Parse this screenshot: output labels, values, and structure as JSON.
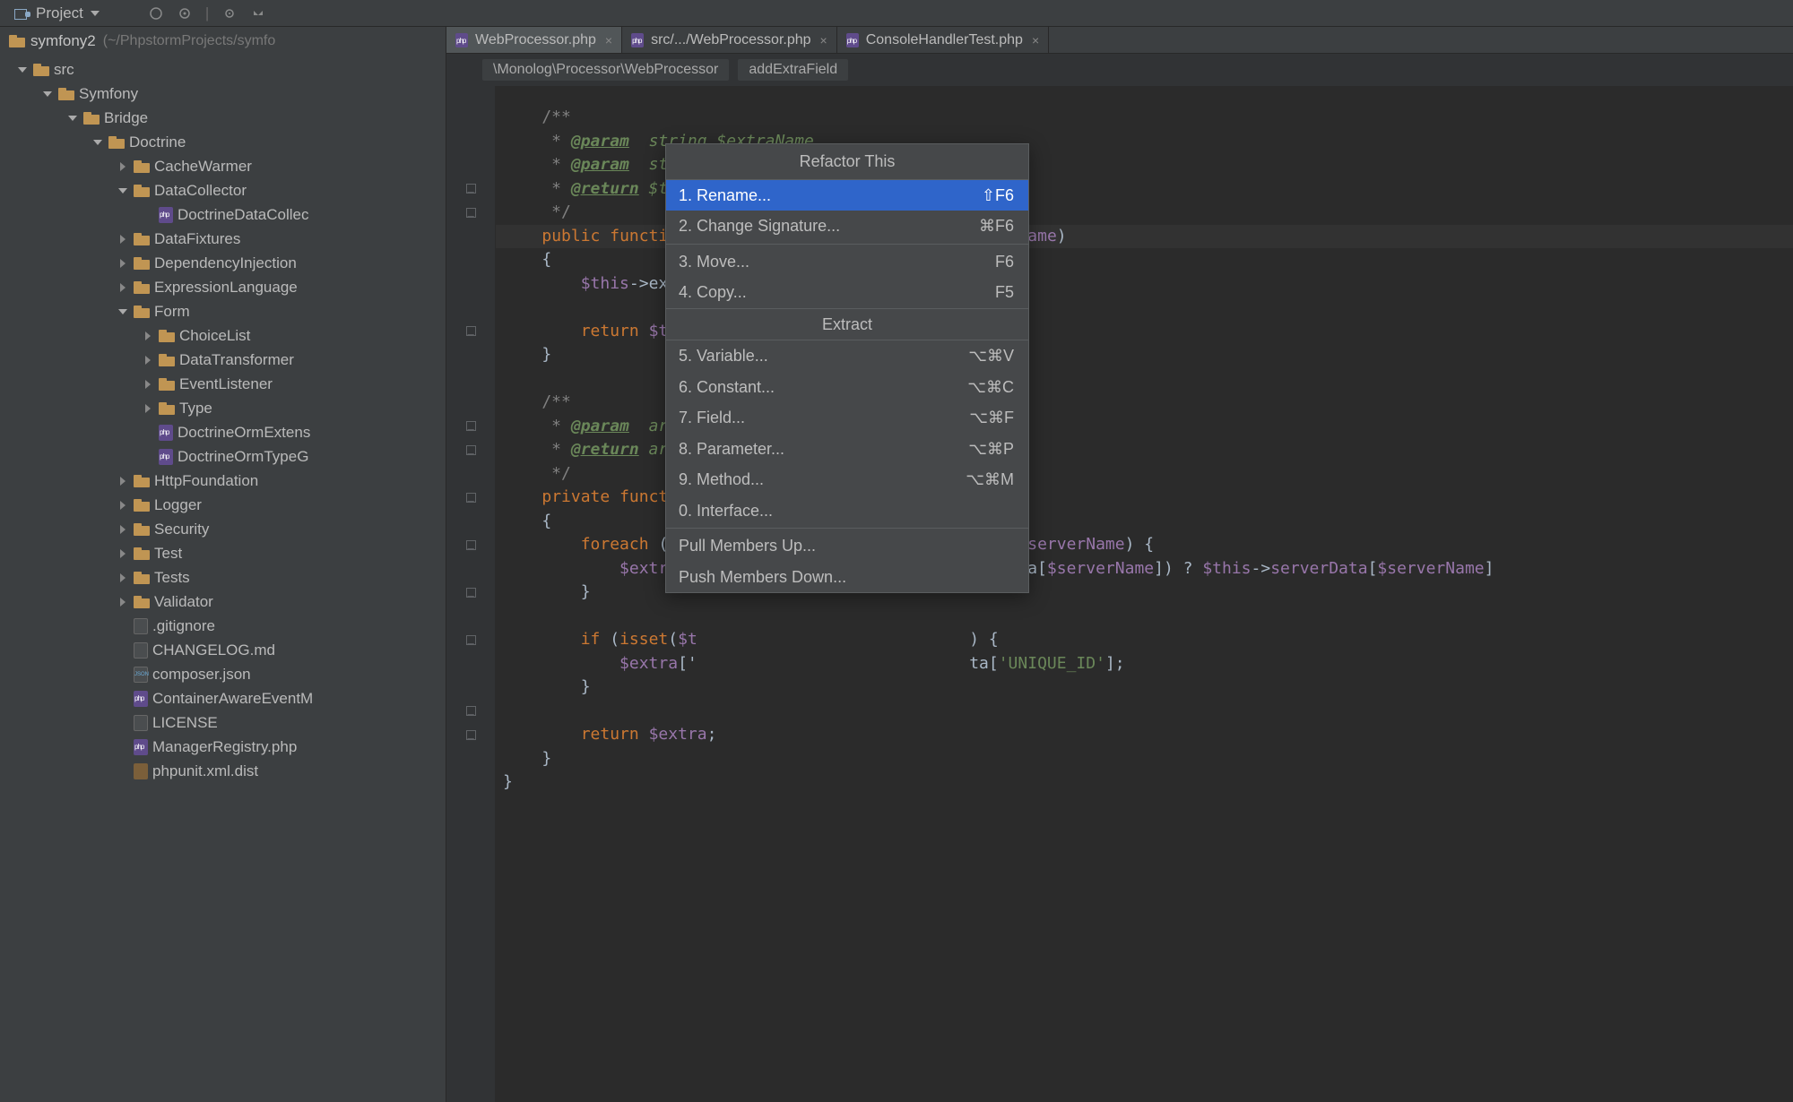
{
  "toolbar": {
    "project_label": "Project"
  },
  "project": {
    "name": "symfony2",
    "path": "(~/PhpstormProjects/symfo"
  },
  "tree": [
    {
      "d": 0,
      "arrow": "exp",
      "icon": "folder",
      "label": "src"
    },
    {
      "d": 1,
      "arrow": "exp",
      "icon": "folder",
      "label": "Symfony"
    },
    {
      "d": 2,
      "arrow": "exp",
      "icon": "folder",
      "label": "Bridge"
    },
    {
      "d": 3,
      "arrow": "exp",
      "icon": "folder",
      "label": "Doctrine"
    },
    {
      "d": 4,
      "arrow": "col",
      "icon": "folder",
      "label": "CacheWarmer"
    },
    {
      "d": 4,
      "arrow": "exp",
      "icon": "folder",
      "label": "DataCollector"
    },
    {
      "d": 5,
      "arrow": "none",
      "icon": "php",
      "label": "DoctrineDataCollec"
    },
    {
      "d": 4,
      "arrow": "col",
      "icon": "folder",
      "label": "DataFixtures"
    },
    {
      "d": 4,
      "arrow": "col",
      "icon": "folder",
      "label": "DependencyInjection"
    },
    {
      "d": 4,
      "arrow": "col",
      "icon": "folder",
      "label": "ExpressionLanguage"
    },
    {
      "d": 4,
      "arrow": "exp",
      "icon": "folder",
      "label": "Form"
    },
    {
      "d": 5,
      "arrow": "col",
      "icon": "folder",
      "label": "ChoiceList"
    },
    {
      "d": 5,
      "arrow": "col",
      "icon": "folder",
      "label": "DataTransformer"
    },
    {
      "d": 5,
      "arrow": "col",
      "icon": "folder",
      "label": "EventListener"
    },
    {
      "d": 5,
      "arrow": "col",
      "icon": "folder",
      "label": "Type"
    },
    {
      "d": 5,
      "arrow": "none",
      "icon": "php",
      "label": "DoctrineOrmExtens"
    },
    {
      "d": 5,
      "arrow": "none",
      "icon": "php",
      "label": "DoctrineOrmTypeG"
    },
    {
      "d": 4,
      "arrow": "col",
      "icon": "folder",
      "label": "HttpFoundation"
    },
    {
      "d": 4,
      "arrow": "col",
      "icon": "folder",
      "label": "Logger"
    },
    {
      "d": 4,
      "arrow": "col",
      "icon": "folder",
      "label": "Security"
    },
    {
      "d": 4,
      "arrow": "col",
      "icon": "folder",
      "label": "Test"
    },
    {
      "d": 4,
      "arrow": "col",
      "icon": "folder",
      "label": "Tests"
    },
    {
      "d": 4,
      "arrow": "col",
      "icon": "folder",
      "label": "Validator"
    },
    {
      "d": 4,
      "arrow": "none",
      "icon": "generic",
      "label": ".gitignore"
    },
    {
      "d": 4,
      "arrow": "none",
      "icon": "md",
      "label": "CHANGELOG.md"
    },
    {
      "d": 4,
      "arrow": "none",
      "icon": "json",
      "label": "composer.json"
    },
    {
      "d": 4,
      "arrow": "none",
      "icon": "php",
      "label": "ContainerAwareEventM"
    },
    {
      "d": 4,
      "arrow": "none",
      "icon": "generic",
      "label": "LICENSE"
    },
    {
      "d": 4,
      "arrow": "none",
      "icon": "php",
      "label": "ManagerRegistry.php"
    },
    {
      "d": 4,
      "arrow": "none",
      "icon": "xml",
      "label": "phpunit.xml.dist"
    }
  ],
  "tabs": [
    {
      "label": "WebProcessor.php",
      "active": true
    },
    {
      "label": "src/.../WebProcessor.php",
      "active": false
    },
    {
      "label": "ConsoleHandlerTest.php",
      "active": false
    }
  ],
  "breadcrumb": {
    "path": "\\Monolog\\Processor\\WebProcessor",
    "method": "addExtraField"
  },
  "code_fragments": {
    "param": "@param",
    "return": "@return",
    "string_extra": "string $extraName",
    "string_server": "string $serverName",
    "this": "$this",
    "array": "array",
    "public": "public",
    "private": "private",
    "function": "function",
    "addExtra": "addExtraField",
    "extraName": "$extraName",
    "serverName": "$serverName",
    "foreach": "foreach",
    "if": "if",
    "isset": "isset",
    "return_kw": "return",
    "extra": "$extra",
    "thisp": "$this",
    "serverData": "serverData",
    "uniq": "'UNIQUE_ID'",
    "brace_o": "{",
    "brace_c": "}"
  },
  "popup": {
    "title": "Refactor This",
    "items_top": [
      {
        "label": "1. Rename...",
        "shortcut": "⇧F6",
        "sel": true
      },
      {
        "label": "2. Change Signature...",
        "shortcut": "⌘F6"
      }
    ],
    "items_mid": [
      {
        "label": "3. Move...",
        "shortcut": "F6"
      },
      {
        "label": "4. Copy...",
        "shortcut": "F5"
      }
    ],
    "section": "Extract",
    "items_extract": [
      {
        "label": "5. Variable...",
        "shortcut": "⌥⌘V"
      },
      {
        "label": "6. Constant...",
        "shortcut": "⌥⌘C"
      },
      {
        "label": "7. Field...",
        "shortcut": "⌥⌘F"
      },
      {
        "label": "8. Parameter...",
        "shortcut": "⌥⌘P"
      },
      {
        "label": "9. Method...",
        "shortcut": "⌥⌘M"
      },
      {
        "label": "0. Interface...",
        "shortcut": ""
      }
    ],
    "items_bottom": [
      {
        "label": "Pull Members Up...",
        "shortcut": ""
      },
      {
        "label": "Push Members Down...",
        "shortcut": ""
      }
    ]
  }
}
